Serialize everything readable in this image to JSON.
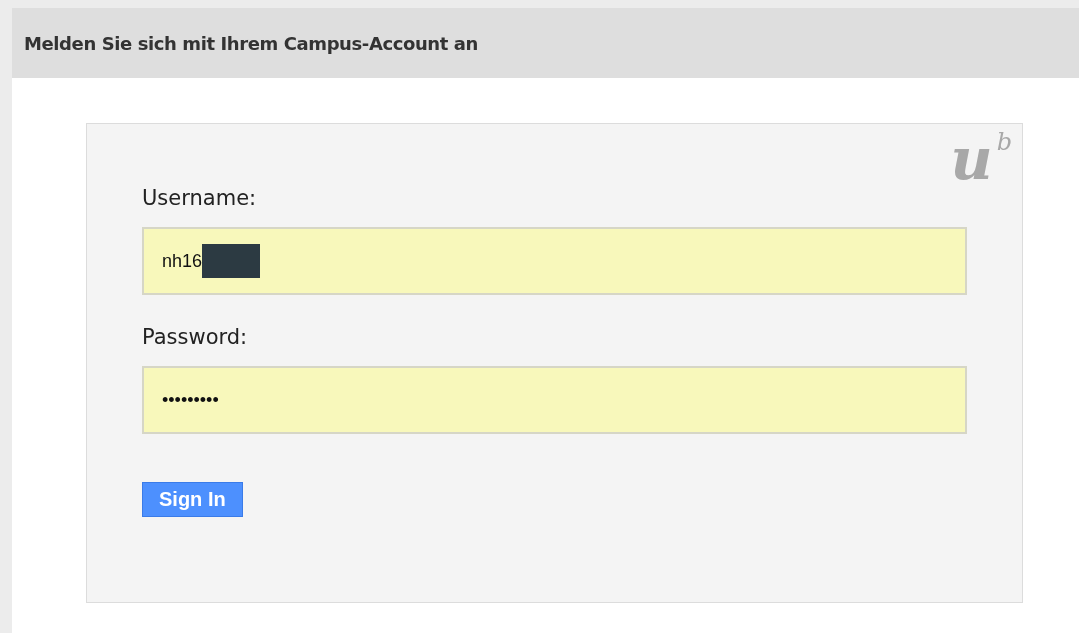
{
  "header": {
    "title": "Melden Sie sich mit Ihrem Campus-Account an"
  },
  "logo": {
    "letter": "u",
    "superscript": "b"
  },
  "fields": [
    {
      "label": "Username:",
      "value": "nh16",
      "redacted": true
    },
    {
      "label": "Password:",
      "value": "•••••••••",
      "redacted": false
    }
  ],
  "button": {
    "label": "Sign In"
  }
}
